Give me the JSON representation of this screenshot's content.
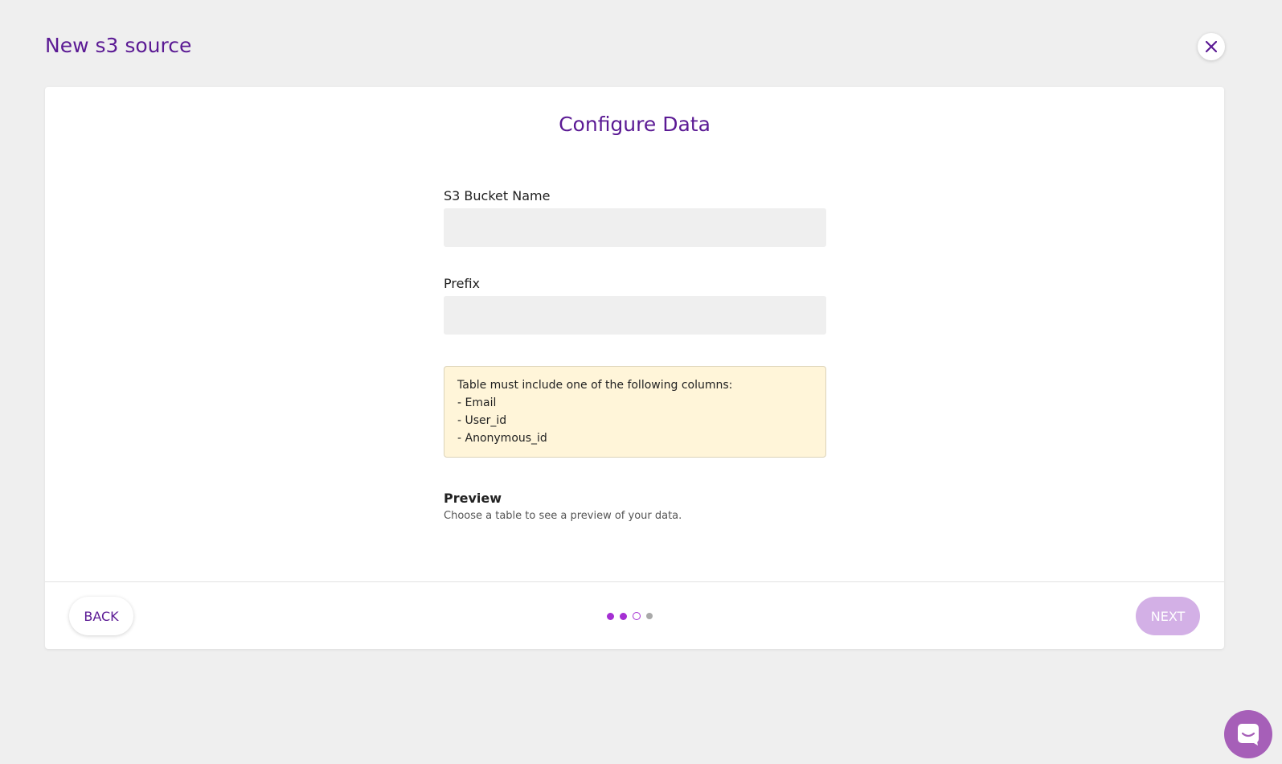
{
  "header": {
    "title": "New s3 source",
    "close_icon": "close-icon"
  },
  "card": {
    "title": "Configure Data",
    "fields": {
      "bucket_label": "S3 Bucket Name",
      "bucket_value": "",
      "prefix_label": "Prefix",
      "prefix_value": ""
    },
    "notice": {
      "line1": "Table must include one of the following columns:",
      "line2": "- Email",
      "line3": "- User_id",
      "line4": "- Anonymous_id"
    },
    "preview": {
      "title": "Preview",
      "subtitle": "Choose a table to see a preview of your data."
    }
  },
  "footer": {
    "back_label": "BACK",
    "next_label": "NEXT",
    "steps_total": 4,
    "current_step": 3
  },
  "colors": {
    "accent": "#5b1a94",
    "step_active": "#a52fd3",
    "next_disabled": "#d3b0e6",
    "notice_bg": "#fff5d9",
    "chat_bubble": "#a65fb8"
  },
  "chat": {
    "icon": "chat-icon"
  }
}
